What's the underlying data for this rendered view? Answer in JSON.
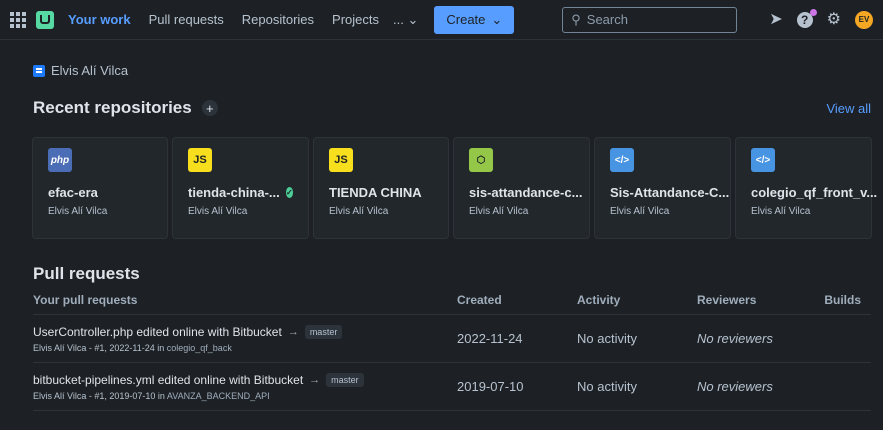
{
  "nav": {
    "items": [
      "Your work",
      "Pull requests",
      "Repositories",
      "Projects"
    ],
    "more": "...",
    "create_label": "Create",
    "search_placeholder": "Search",
    "avatar_initials": "EV"
  },
  "workspace": {
    "name": "Elvis Alí Vilca"
  },
  "recent": {
    "title": "Recent repositories",
    "view_all": "View all",
    "repos": [
      {
        "icon_label": "php",
        "name": "efac-era",
        "owner": "Elvis Alí Vilca"
      },
      {
        "icon_label": "JS",
        "name": "tienda-china-...",
        "owner": "Elvis Alí Vilca"
      },
      {
        "icon_label": "JS",
        "name": "TIENDA CHINA",
        "owner": "Elvis Alí Vilca"
      },
      {
        "icon_label": "⬡",
        "name": "sis-attandance-c...",
        "owner": "Elvis Alí Vilca"
      },
      {
        "icon_label": "</>",
        "name": "Sis-Attandance-C...",
        "owner": "Elvis Alí Vilca"
      },
      {
        "icon_label": "</>",
        "name": "colegio_qf_front_v...",
        "owner": "Elvis Alí Vilca"
      }
    ]
  },
  "pull_requests": {
    "title": "Pull requests",
    "headers": {
      "main": "Your pull requests",
      "created": "Created",
      "activity": "Activity",
      "reviewers": "Reviewers",
      "builds": "Builds"
    },
    "rows": [
      {
        "title": "UserController.php edited online with Bitbucket",
        "branch": "master",
        "meta": "Elvis Alí Vilca - #1, 2022-11-24 in",
        "repo": "colegio_qf_back",
        "created": "2022-11-24",
        "activity": "No activity",
        "reviewers": "No reviewers"
      },
      {
        "title": "bitbucket-pipelines.yml edited online with Bitbucket",
        "branch": "master",
        "meta": "Elvis Alí Vilca - #1, 2019-07-10 in",
        "repo": "AVANZA_BACKEND_API",
        "created": "2019-07-10",
        "activity": "No activity",
        "reviewers": "No reviewers"
      }
    ]
  }
}
